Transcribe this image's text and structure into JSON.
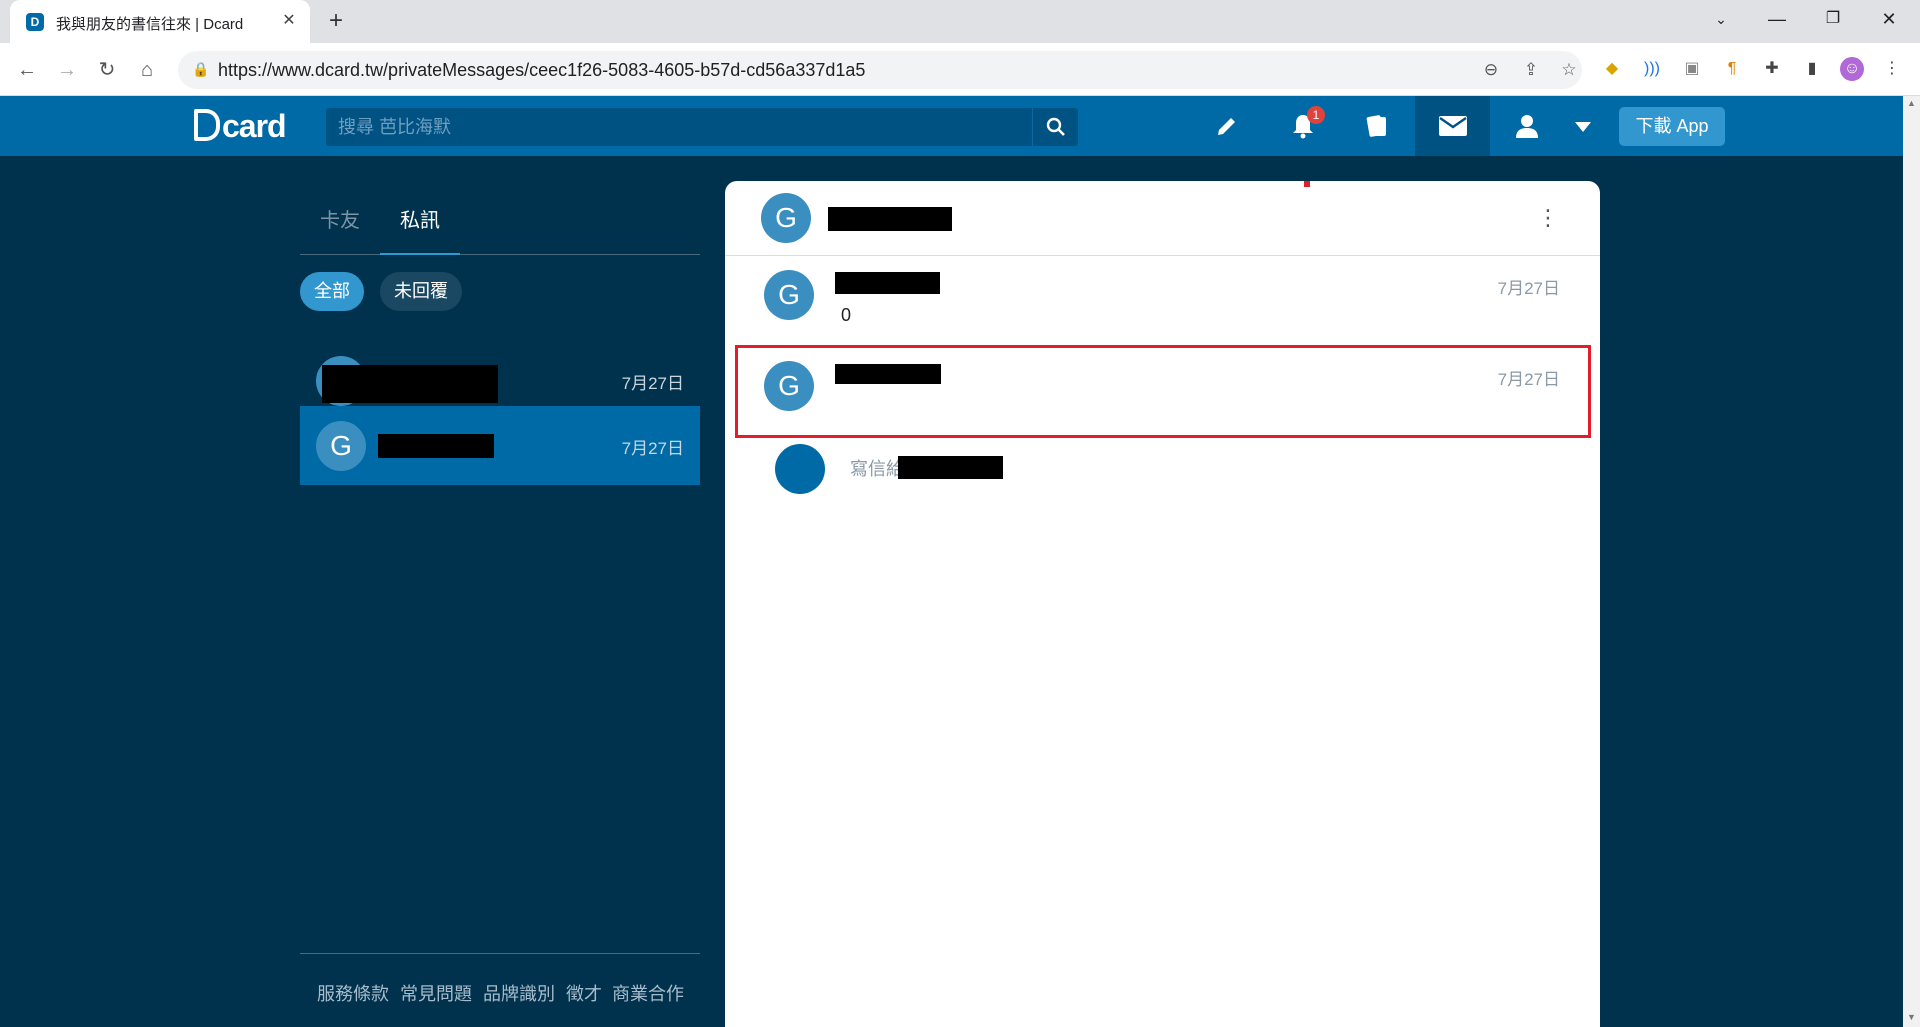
{
  "browser": {
    "tab_title": "我與朋友的書信往來 | Dcard",
    "tab_favicon": "D",
    "close_symbol": "✕",
    "newtab_symbol": "+",
    "url": "https://www.dcard.tw/privateMessages/ceec1f26-5083-4605-b57d-cd56a337d1a5"
  },
  "header": {
    "logo_text": "card",
    "search_placeholder": "搜尋 芭比海默",
    "notification_count": "1",
    "download_label": "下載 App",
    "icons": [
      "pencil-icon",
      "bell-icon",
      "cards-icon",
      "mail-icon",
      "user-icon",
      "caret-down-icon"
    ]
  },
  "sidebar": {
    "tabs": [
      "卡友",
      "私訊"
    ],
    "filters": [
      "全部",
      "未回覆"
    ],
    "conversations": [
      {
        "avatar": "",
        "date": "7月27日"
      },
      {
        "avatar": "G",
        "date": "7月27日"
      }
    ],
    "footer": [
      "服務條款",
      "常見問題",
      "品牌識別",
      "徵才",
      "商業合作"
    ]
  },
  "chat": {
    "header_avatar": "G",
    "messages": [
      {
        "avatar": "G",
        "date": "7月27日",
        "body": "0"
      },
      {
        "avatar": "G",
        "date": "7月27日",
        "body": ""
      }
    ],
    "compose_placeholder": "寫信給"
  },
  "colors": {
    "page_bg": "#00324e",
    "brand": "#006aa6",
    "accent": "#3397cf",
    "highlight": "#e31d2b"
  }
}
